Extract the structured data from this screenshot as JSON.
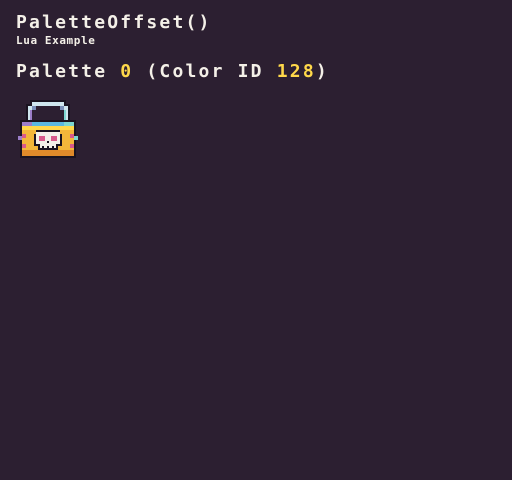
{
  "title": "PaletteOffset()",
  "subtitle": "Lua Example",
  "info": {
    "prefix": "Palette ",
    "palette_index": "0",
    "middle": " (Color ID ",
    "color_id": "128",
    "suffix": ")"
  },
  "sprite": {
    "icon": "padlock-skull-icon"
  },
  "colors": {
    "background": "#2c1f31",
    "text": "#f4f0e8",
    "highlight": "#ffd84a"
  }
}
